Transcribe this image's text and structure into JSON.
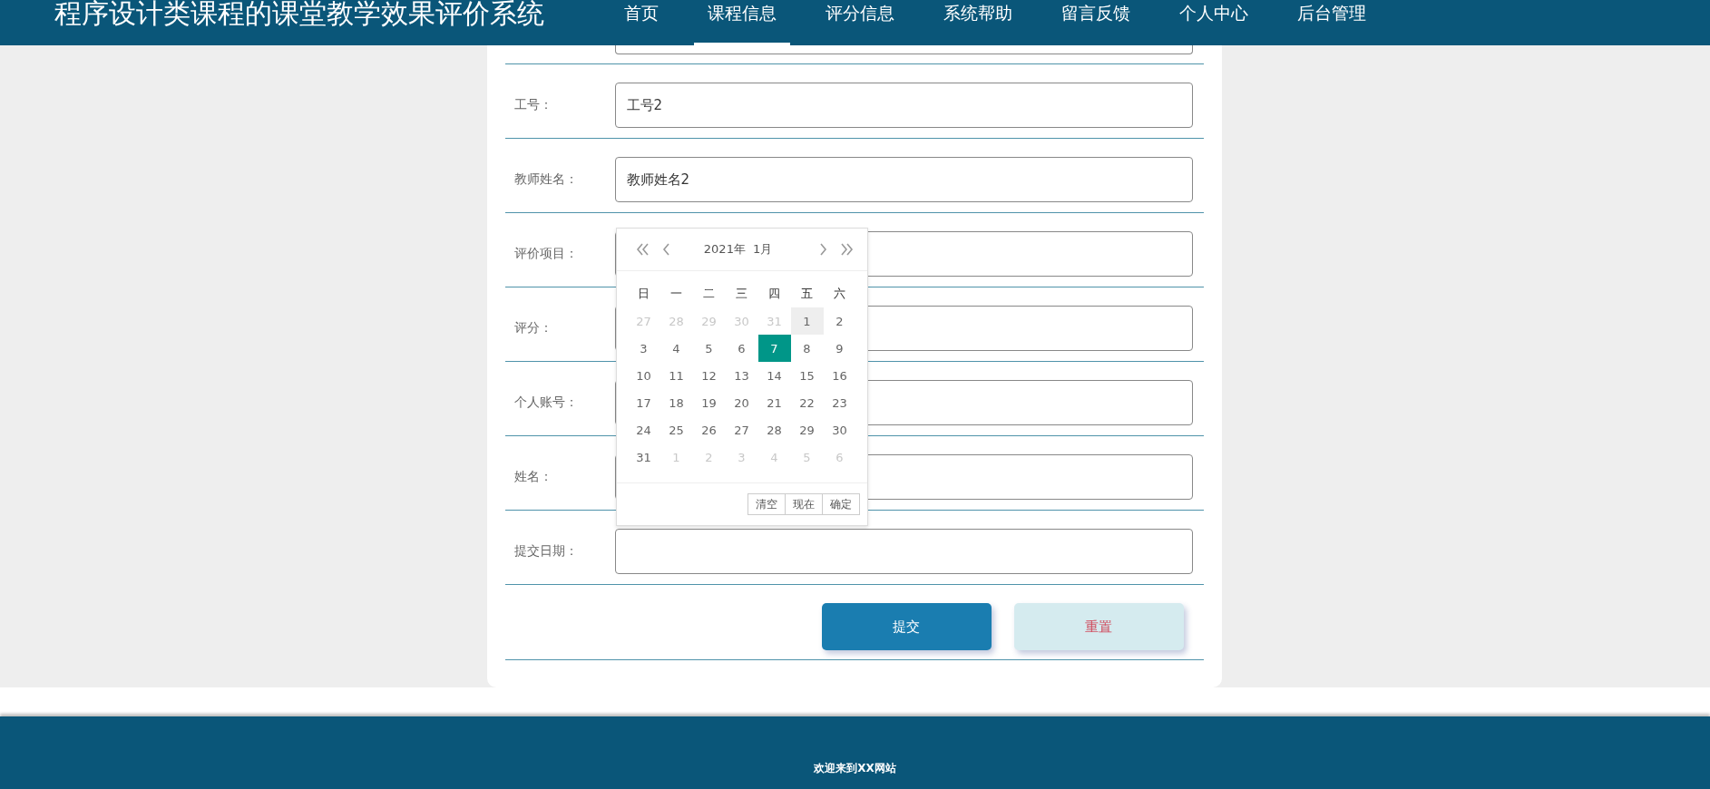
{
  "header": {
    "title": "程序设计类课程的课堂教学效果评价系统",
    "nav": [
      {
        "label": "首页",
        "selected": false
      },
      {
        "label": "课程信息",
        "selected": true
      },
      {
        "label": "评分信息",
        "selected": false
      },
      {
        "label": "系统帮助",
        "selected": false
      },
      {
        "label": "留言反馈",
        "selected": false
      },
      {
        "label": "个人中心",
        "selected": false
      },
      {
        "label": "后台管理",
        "selected": false
      }
    ]
  },
  "form": {
    "fields": [
      {
        "label": "工号：",
        "value": "工号2"
      },
      {
        "label": "教师姓名：",
        "value": "教师姓名2"
      },
      {
        "label": "评价项目："
      },
      {
        "label": "评分："
      },
      {
        "label": "个人账号："
      },
      {
        "label": "姓名："
      },
      {
        "label": "提交日期："
      }
    ],
    "buttons": [
      {
        "label": "提交",
        "kind": "primary"
      },
      {
        "label": "重置",
        "kind": "reset"
      }
    ]
  },
  "date_picker": {
    "year": "2021年",
    "month": "1月",
    "weekdays": [
      "日",
      "一",
      "二",
      "三",
      "四",
      "五",
      "六"
    ],
    "days": [
      {
        "text": "27",
        "outside": true,
        "selected": false,
        "hover": false
      },
      {
        "text": "28",
        "outside": true,
        "selected": false,
        "hover": false
      },
      {
        "text": "29",
        "outside": true,
        "selected": false,
        "hover": false
      },
      {
        "text": "30",
        "outside": true,
        "selected": false,
        "hover": false
      },
      {
        "text": "31",
        "outside": true,
        "selected": false,
        "hover": false
      },
      {
        "text": "1",
        "outside": false,
        "selected": false,
        "hover": true
      },
      {
        "text": "2",
        "outside": false,
        "selected": false,
        "hover": false
      },
      {
        "text": "3",
        "outside": false,
        "selected": false,
        "hover": false
      },
      {
        "text": "4",
        "outside": false,
        "selected": false,
        "hover": false
      },
      {
        "text": "5",
        "outside": false,
        "selected": false,
        "hover": false
      },
      {
        "text": "6",
        "outside": false,
        "selected": false,
        "hover": false
      },
      {
        "text": "7",
        "outside": false,
        "selected": true,
        "hover": false
      },
      {
        "text": "8",
        "outside": false,
        "selected": false,
        "hover": false
      },
      {
        "text": "9",
        "outside": false,
        "selected": false,
        "hover": false
      },
      {
        "text": "10",
        "outside": false,
        "selected": false,
        "hover": false
      },
      {
        "text": "11",
        "outside": false,
        "selected": false,
        "hover": false
      },
      {
        "text": "12",
        "outside": false,
        "selected": false,
        "hover": false
      },
      {
        "text": "13",
        "outside": false,
        "selected": false,
        "hover": false
      },
      {
        "text": "14",
        "outside": false,
        "selected": false,
        "hover": false
      },
      {
        "text": "15",
        "outside": false,
        "selected": false,
        "hover": false
      },
      {
        "text": "16",
        "outside": false,
        "selected": false,
        "hover": false
      },
      {
        "text": "17",
        "outside": false,
        "selected": false,
        "hover": false
      },
      {
        "text": "18",
        "outside": false,
        "selected": false,
        "hover": false
      },
      {
        "text": "19",
        "outside": false,
        "selected": false,
        "hover": false
      },
      {
        "text": "20",
        "outside": false,
        "selected": false,
        "hover": false
      },
      {
        "text": "21",
        "outside": false,
        "selected": false,
        "hover": false
      },
      {
        "text": "22",
        "outside": false,
        "selected": false,
        "hover": false
      },
      {
        "text": "23",
        "outside": false,
        "selected": false,
        "hover": false
      },
      {
        "text": "24",
        "outside": false,
        "selected": false,
        "hover": false
      },
      {
        "text": "25",
        "outside": false,
        "selected": false,
        "hover": false
      },
      {
        "text": "26",
        "outside": false,
        "selected": false,
        "hover": false
      },
      {
        "text": "27",
        "outside": false,
        "selected": false,
        "hover": false
      },
      {
        "text": "28",
        "outside": false,
        "selected": false,
        "hover": false
      },
      {
        "text": "29",
        "outside": false,
        "selected": false,
        "hover": false
      },
      {
        "text": "30",
        "outside": false,
        "selected": false,
        "hover": false
      },
      {
        "text": "31",
        "outside": false,
        "selected": false,
        "hover": false
      },
      {
        "text": "1",
        "outside": true,
        "selected": false,
        "hover": false
      },
      {
        "text": "2",
        "outside": true,
        "selected": false,
        "hover": false
      },
      {
        "text": "3",
        "outside": true,
        "selected": false,
        "hover": false
      },
      {
        "text": "4",
        "outside": true,
        "selected": false,
        "hover": false
      },
      {
        "text": "5",
        "outside": true,
        "selected": false,
        "hover": false
      },
      {
        "text": "6",
        "outside": true,
        "selected": false,
        "hover": false
      }
    ],
    "buttons": [
      "清空",
      "现在",
      "确定"
    ]
  },
  "footer": {
    "text": "欢迎来到XX网站"
  }
}
